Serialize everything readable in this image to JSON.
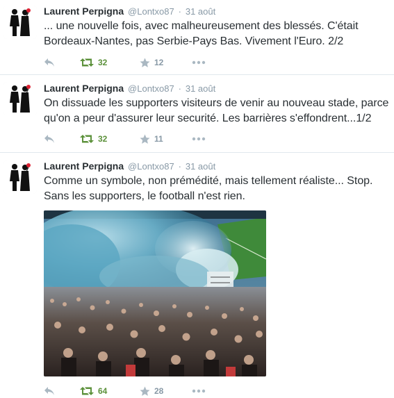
{
  "tweets": [
    {
      "author": "Laurent Perpigna",
      "handle": "@Lontxo87",
      "separator": "·",
      "date": "31 août",
      "text_lines": [
        "... une nouvelle fois, avec malheureusement des blessés. C'était",
        "Bordeaux-Nantes, pas Serbie-Pays Bas. Vivement l'Euro. 2/2"
      ],
      "retweets": "32",
      "favorites": "12",
      "icons": {
        "reply": "reply-icon",
        "retweet": "retweet-icon",
        "favorite": "star-icon",
        "more": "more-dots-icon"
      }
    },
    {
      "author": "Laurent Perpigna",
      "handle": "@Lontxo87",
      "separator": "·",
      "date": "31 août",
      "text_lines": [
        "On dissuade les supporters visiteurs de venir au nouveau stade, parce",
        "qu'on a peur d'assurer leur securité. Les barrières s'effondrent...1/2"
      ],
      "retweets": "32",
      "favorites": "11",
      "icons": {
        "reply": "reply-icon",
        "retweet": "retweet-icon",
        "favorite": "star-icon",
        "more": "more-dots-icon"
      }
    },
    {
      "author": "Laurent Perpigna",
      "handle": "@Lontxo87",
      "separator": "·",
      "date": "31 août",
      "text_lines": [
        "Comme un symbole, non prémédité, mais tellement réaliste... Stop.",
        "Sans les supporters, le football n'est rien."
      ],
      "retweets": "64",
      "favorites": "28",
      "icons": {
        "reply": "reply-icon",
        "retweet": "retweet-icon",
        "favorite": "star-icon",
        "more": "more-dots-icon"
      }
    }
  ],
  "colors": {
    "retweet_green": "#5c913b",
    "meta_gray": "#8899a6",
    "text": "#292f33",
    "divider": "#e1e8ed"
  }
}
